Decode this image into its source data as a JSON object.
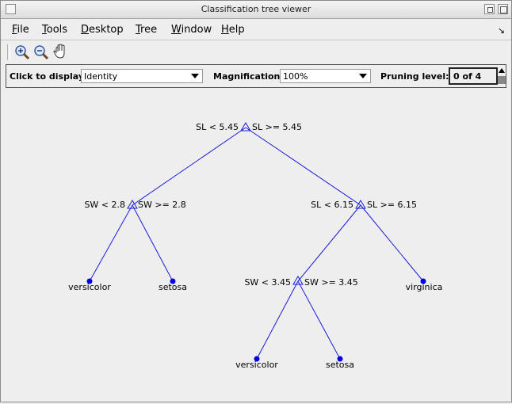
{
  "window": {
    "title": "Classification tree viewer"
  },
  "menu": {
    "file": {
      "accel": "F",
      "rest": "ile"
    },
    "tools": {
      "accel": "T",
      "rest": "ools"
    },
    "desktop": {
      "accel": "D",
      "rest": "esktop"
    },
    "tree": {
      "accel": "T",
      "rest": "ree"
    },
    "window": {
      "accel": "W",
      "rest": "indow"
    },
    "help": {
      "accel": "H",
      "rest": "elp"
    }
  },
  "controls": {
    "display_label": "Click to display:",
    "display_value": "Identity",
    "magnification_label": "Magnification:",
    "magnification_value": "100%",
    "pruning_label": "Pruning level:",
    "pruning_value": "0 of 4"
  },
  "tree": {
    "colors": {
      "line": "#1a1adc",
      "leaf": "#0000e6"
    },
    "root": {
      "left_label": "SL < 5.45",
      "right_label": "SL >= 5.45"
    },
    "n2": {
      "left_label": "SW < 2.8",
      "right_label": "SW >= 2.8"
    },
    "n3": {
      "left_label": "SL < 6.15",
      "right_label": "SL >= 6.15"
    },
    "n6": {
      "left_label": "SW < 3.45",
      "right_label": "SW >= 3.45"
    },
    "leaves": {
      "l1": "versicolor",
      "l2": "setosa",
      "l3": "virginica",
      "l4": "versicolor",
      "l5": "setosa"
    }
  }
}
